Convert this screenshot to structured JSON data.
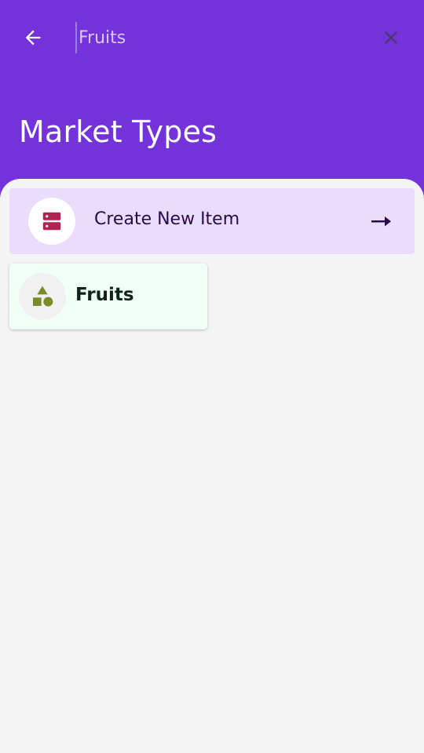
{
  "search": {
    "value": "Fruits",
    "placeholder": ""
  },
  "header": {
    "title": "Market Types",
    "back_icon": "arrow-left-icon",
    "clear_icon": "close-icon"
  },
  "create_item": {
    "label": "Create New Item",
    "icon": "storage-icon",
    "arrow_icon": "arrow-right-icon"
  },
  "categories": [
    {
      "label": "Fruits",
      "icon": "category-shapes-icon"
    }
  ],
  "colors": {
    "header_bg": "#7432da",
    "create_card_bg": "#eadcfc",
    "category_card_bg": "#f0fff8",
    "create_icon": "#b0224f",
    "category_icon": "#7c8a2a",
    "page_bg": "#f4f4f4"
  }
}
